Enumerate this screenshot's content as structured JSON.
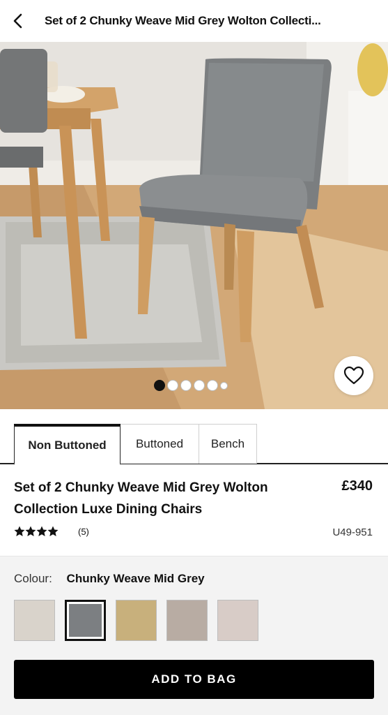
{
  "topbar": {
    "title": "Set of 2 Chunky Weave Mid Grey Wolton Collecti..."
  },
  "gallery": {
    "image_count": 6,
    "active_index": 0
  },
  "tabs": [
    {
      "label": "Non Buttoned",
      "active": true
    },
    {
      "label": "Buttoned",
      "active": false
    },
    {
      "label": "Bench",
      "active": false
    }
  ],
  "product": {
    "title": "Set of 2 Chunky Weave Mid Grey Wolton Collection Luxe Dining Chairs",
    "price": "£340",
    "rating_stars": "★★★★★",
    "rating_value": 4.5,
    "review_count": "(5)",
    "sku": "U49-951"
  },
  "colour": {
    "label": "Colour:",
    "selected": "Chunky Weave Mid Grey",
    "swatches": [
      {
        "color": "#d9d3cb",
        "selected": false
      },
      {
        "color": "#7c7f82",
        "selected": true
      },
      {
        "color": "#c8b07c",
        "selected": false
      },
      {
        "color": "#b8aca3",
        "selected": false
      },
      {
        "color": "#d8ccc7",
        "selected": false
      }
    ]
  },
  "cta": {
    "add_to_bag": "ADD TO BAG"
  }
}
